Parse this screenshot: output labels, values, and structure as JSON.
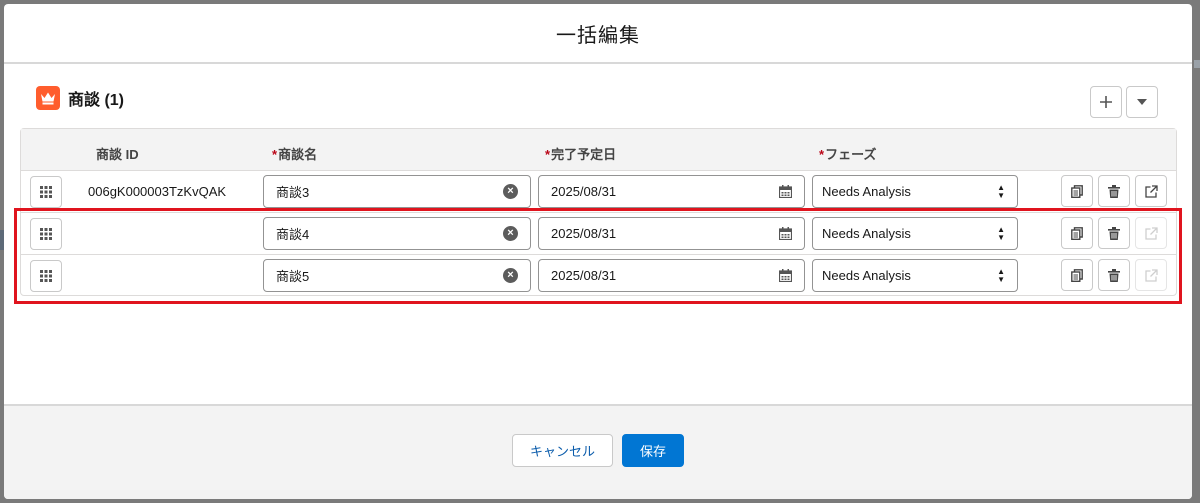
{
  "modal": {
    "title": "一括編集"
  },
  "section": {
    "title": "商談 (1)",
    "icon": "crown-icon",
    "accent": "#ff5d2d"
  },
  "header_buttons": {
    "add_icon": "plus-icon",
    "menu_icon": "chevron-down-icon"
  },
  "columns": [
    {
      "label": "商談 ID",
      "required": false
    },
    {
      "label": "商談名",
      "required": true
    },
    {
      "label": "完了予定日",
      "required": true
    },
    {
      "label": "フェーズ",
      "required": true
    }
  ],
  "required_mark": "*",
  "rows": [
    {
      "id": "006gK000003TzKvQAK",
      "name": "商談3",
      "close_date": "2025/08/31",
      "stage": "Needs Analysis",
      "open_enabled": true
    },
    {
      "id": "",
      "name": "商談4",
      "close_date": "2025/08/31",
      "stage": "Needs Analysis",
      "open_enabled": false
    },
    {
      "id": "",
      "name": "商談5",
      "close_date": "2025/08/31",
      "stage": "Needs Analysis",
      "open_enabled": false
    }
  ],
  "footer": {
    "cancel_label": "キャンセル",
    "save_label": "保存"
  },
  "colors": {
    "brand": "#0176d3",
    "required": "#ba0517",
    "highlight": "#e0141e"
  }
}
